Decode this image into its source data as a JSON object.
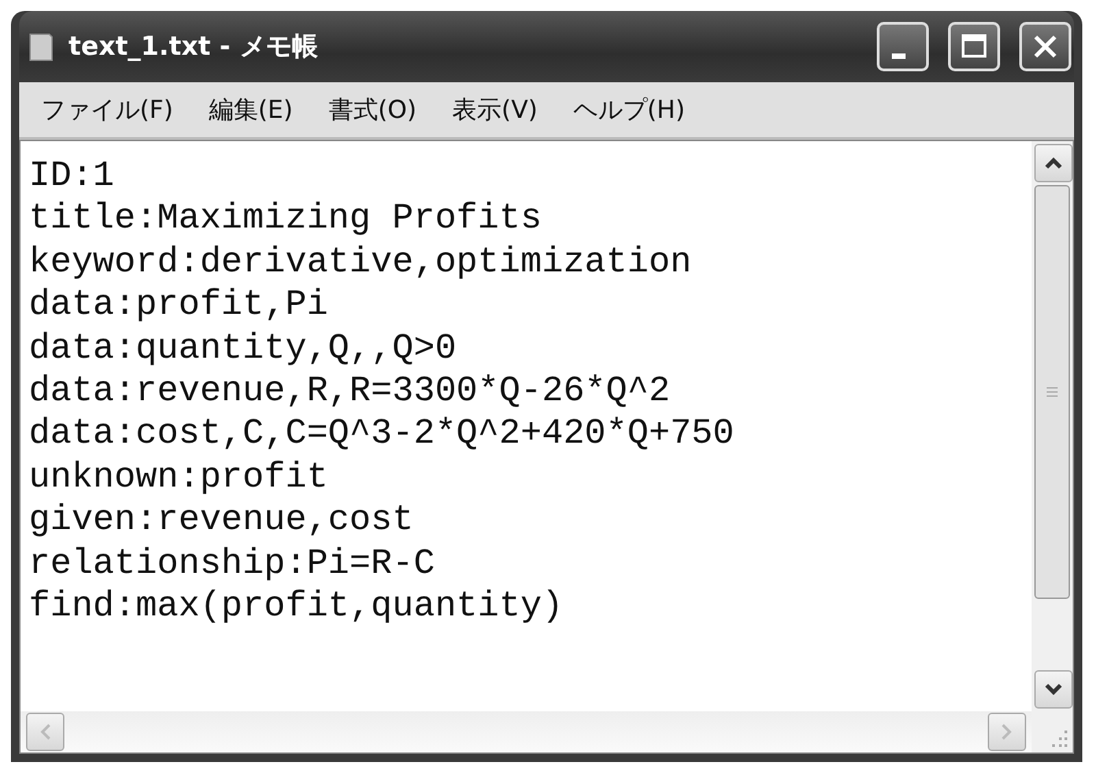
{
  "window": {
    "title": "text_1.txt - メモ帳"
  },
  "menu": [
    {
      "label": "ファイル(F)"
    },
    {
      "label": "編集(E)"
    },
    {
      "label": "書式(O)"
    },
    {
      "label": "表示(V)"
    },
    {
      "label": "ヘルプ(H)"
    }
  ],
  "document": {
    "lines": [
      "ID:1",
      "title:Maximizing Profits",
      "keyword:derivative,optimization",
      "data:profit,Pi",
      "data:quantity,Q,,Q>0",
      "data:revenue,R,R=3300*Q-26*Q^2",
      "data:cost,C,C=Q^3-2*Q^2+420*Q+750",
      "unknown:profit",
      "given:revenue,cost",
      "relationship:Pi=R-C",
      "find:max(profit,quantity)"
    ]
  }
}
